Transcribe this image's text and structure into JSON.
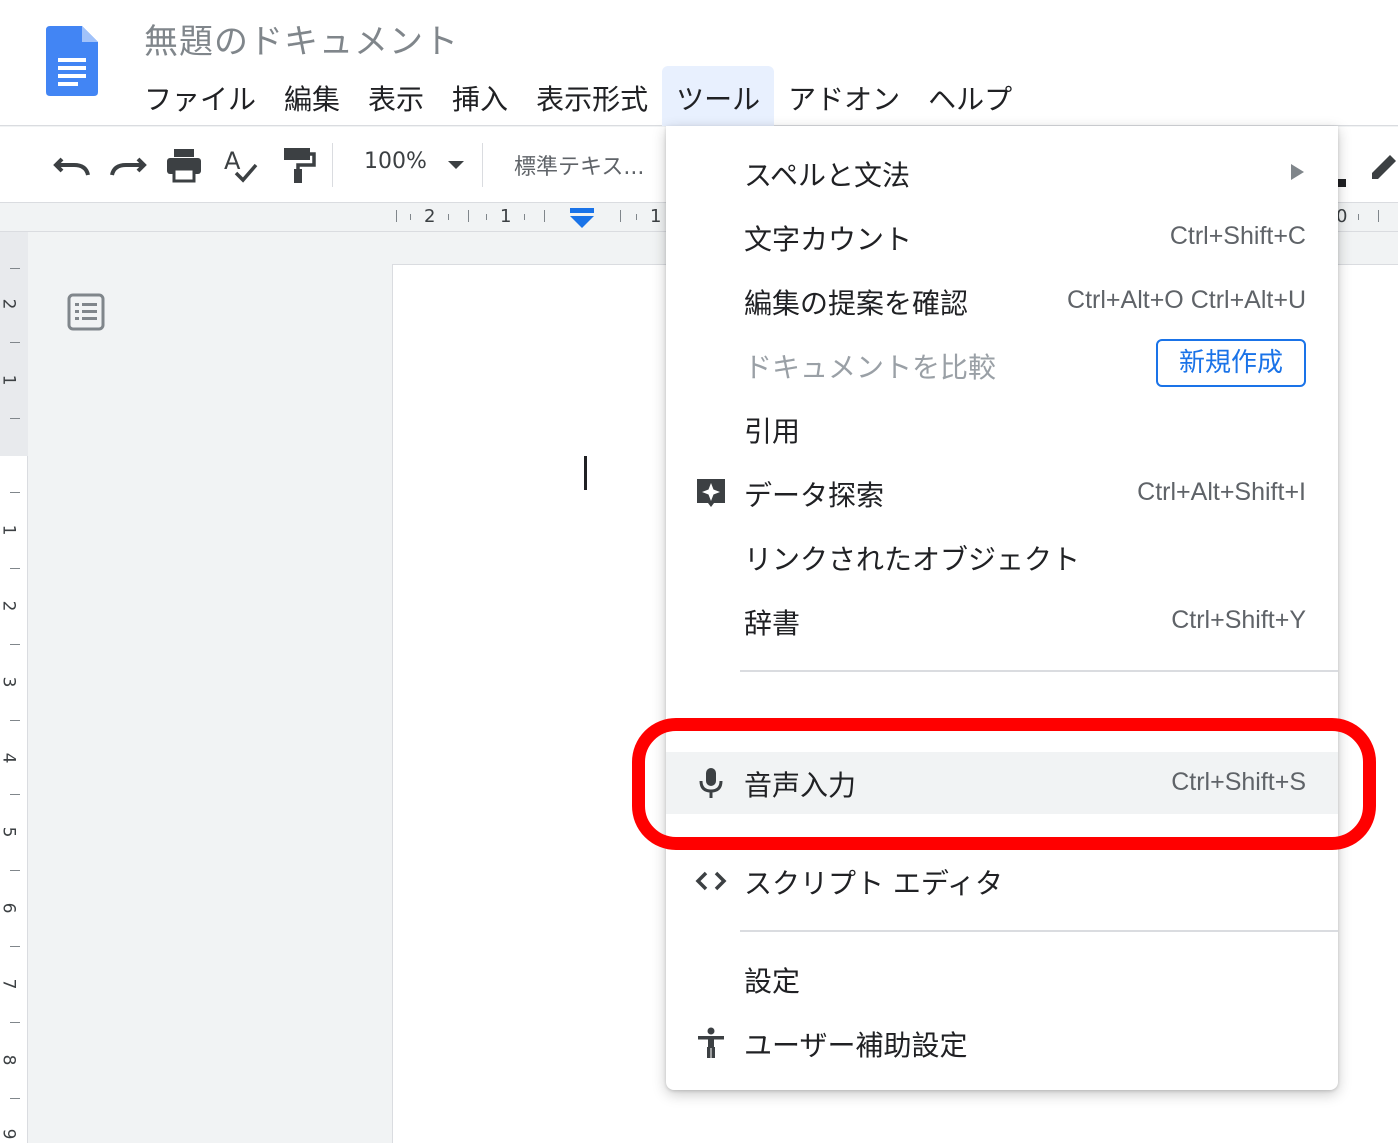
{
  "doc": {
    "title": "無題のドキュメント"
  },
  "menubar": [
    "ファイル",
    "編集",
    "表示",
    "挿入",
    "表示形式",
    "ツール",
    "アドオン",
    "ヘルプ"
  ],
  "toolbar": {
    "zoom": "100%",
    "style": "標準テキス..."
  },
  "ruler_h": {
    "labels": [
      "2",
      "1",
      "1",
      "0",
      "1"
    ]
  },
  "ruler_v": {
    "labels": [
      "2",
      "1",
      "1",
      "2",
      "3",
      "4",
      "5",
      "6",
      "7",
      "8",
      "9"
    ]
  },
  "tools_menu": {
    "items": [
      {
        "label": "スペルと文法",
        "has_submenu": true
      },
      {
        "label": "文字カウント",
        "shortcut": "Ctrl+Shift+C"
      },
      {
        "label": "編集の提案を確認",
        "shortcut": "Ctrl+Alt+O Ctrl+Alt+U"
      },
      {
        "label": "ドキュメントを比較",
        "disabled": true,
        "button": "新規作成"
      },
      {
        "label": "引用"
      },
      {
        "label": "データ探索",
        "shortcut": "Ctrl+Alt+Shift+I",
        "icon": "explore-icon"
      },
      {
        "label": "リンクされたオブジェクト"
      },
      {
        "label": "辞書",
        "shortcut": "Ctrl+Shift+Y"
      },
      {
        "label": "音声入力",
        "shortcut": "Ctrl+Shift+S",
        "icon": "microphone-icon",
        "highlighted": true
      },
      {
        "label": "スクリプト エディタ",
        "icon": "code-icon"
      },
      {
        "label": "設定"
      },
      {
        "label": "ユーザー補助設定",
        "icon": "accessibility-icon"
      }
    ]
  },
  "colors": {
    "accent": "#1a73e8",
    "highlight_ring": "#ff0000",
    "menu_active_bg": "#e8f0fe"
  }
}
